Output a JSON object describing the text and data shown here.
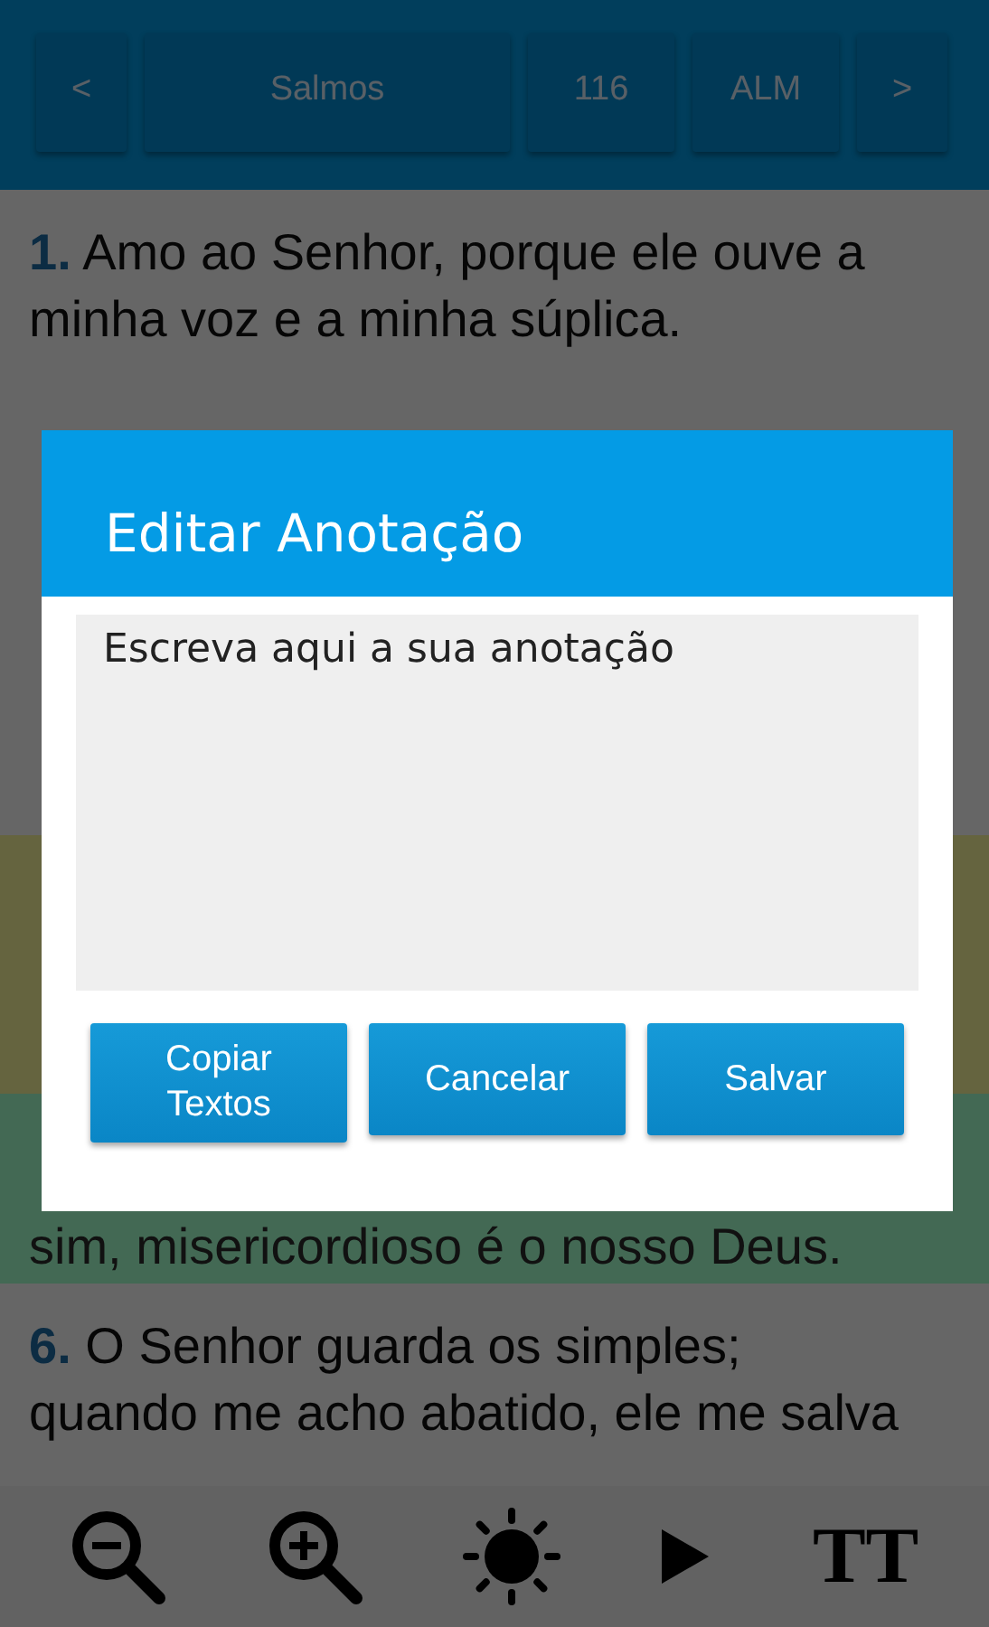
{
  "header": {
    "buttons": [
      {
        "label": "<",
        "kind": "narrow"
      },
      {
        "label": "Salmos",
        "kind": "wide"
      },
      {
        "label": "116",
        "kind": "medium"
      },
      {
        "label": "ALM",
        "kind": "medium"
      },
      {
        "label": ">",
        "kind": "narrow"
      }
    ]
  },
  "verses": [
    {
      "kind": "verse",
      "number": "1.",
      "text": "Amo ao Senhor, porque ele ouve a minha voz e a minha súplica."
    },
    {
      "kind": "covered",
      "color": "#65643f"
    },
    {
      "kind": "covered",
      "color": "#436954",
      "tail": "sim, misericordioso é o nosso Deus."
    },
    {
      "kind": "verse",
      "number": "6.",
      "text": "O Senhor guarda os simples; quando me acho abatido, ele me salva"
    }
  ],
  "toolbar": [
    {
      "kind": "zoom-out"
    },
    {
      "kind": "zoom-in"
    },
    {
      "kind": "brightness"
    },
    {
      "kind": "play"
    },
    {
      "kind": "font-size",
      "label": "TT"
    }
  ],
  "dialog": {
    "title": "Editar Anotação",
    "placeholder": "Escreva aqui a sua anotação",
    "buttons": [
      "Copiar Textos",
      "Cancelar",
      "Salvar"
    ]
  }
}
